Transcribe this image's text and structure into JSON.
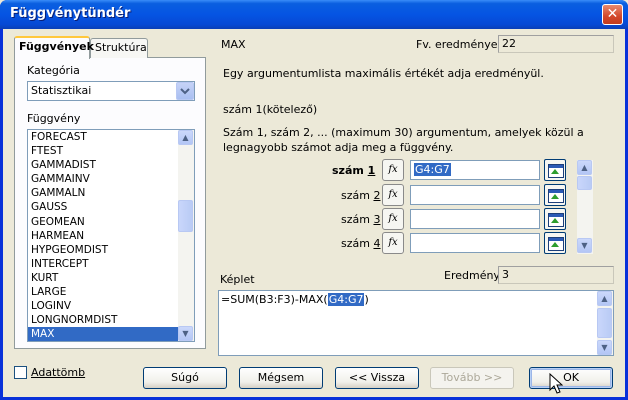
{
  "window": {
    "title": "Függvénytündér",
    "close_glyph": "✕"
  },
  "tabs": [
    {
      "label": "Függvények",
      "active": true
    },
    {
      "label": "Struktúra",
      "active": false
    }
  ],
  "category": {
    "label": "Kategória",
    "value": "Statisztikai"
  },
  "functions": {
    "label": "Függvény",
    "items": [
      "FORECAST",
      "FTEST",
      "GAMMADIST",
      "GAMMAINV",
      "GAMMALN",
      "GAUSS",
      "GEOMEAN",
      "HARMEAN",
      "HYPGEOMDIST",
      "INTERCEPT",
      "KURT",
      "LARGE",
      "LOGINV",
      "LONGNORMDIST",
      "MAX"
    ],
    "selected": "MAX"
  },
  "function_info": {
    "name": "MAX",
    "result_label": "Fv. eredménye:",
    "result_value": "22",
    "description": "Egy argumentumlista maximális értékét adja eredményül.",
    "arg_title": "szám 1(kötelező)",
    "arg_description": "Szám 1, szám 2, ... (maximum 30) argumentum, amelyek közül a legnagyobb számot adja meg a függvény."
  },
  "arguments": [
    {
      "label_prefix": "szám ",
      "label_num": "1",
      "value": "G4:G7",
      "bold": true
    },
    {
      "label_prefix": "szám ",
      "label_num": "2",
      "value": ""
    },
    {
      "label_prefix": "szám ",
      "label_num": "3",
      "value": ""
    },
    {
      "label_prefix": "szám ",
      "label_num": "4",
      "value": ""
    }
  ],
  "fx_glyph": "fx",
  "formula": {
    "label": "Képlet",
    "result_label": "Eredmény",
    "result_value": "3",
    "prefix": "=SUM(B3:F3)-MAX(",
    "selected": "G4:G7",
    "suffix": ")"
  },
  "array_checkbox": {
    "label": "Adattömb",
    "checked": false
  },
  "buttons": {
    "help": "Súgó",
    "cancel": "Mégsem",
    "back": "<< Vissza",
    "next": "Tovább >>",
    "ok": "OK"
  }
}
